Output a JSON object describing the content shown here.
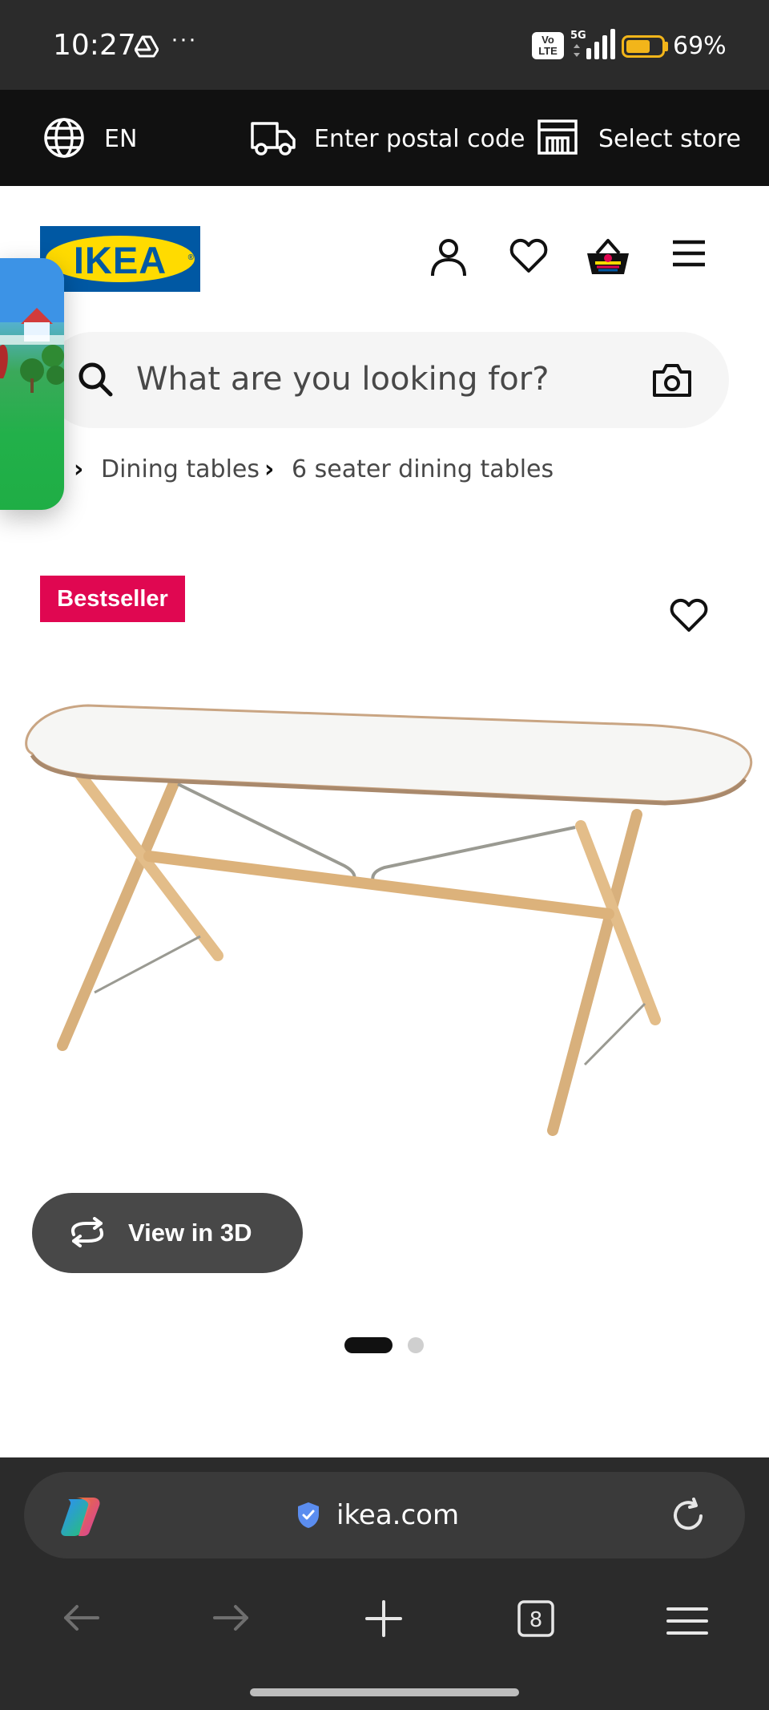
{
  "status_bar": {
    "time": "10:27",
    "more": "···",
    "volte": [
      "Vo",
      "LTE"
    ],
    "network": "5G",
    "battery_level": 0.69,
    "battery_percent": "69%"
  },
  "topbar": {
    "language": "EN",
    "postal_code_label": "Enter postal code",
    "store_label": "Select store"
  },
  "header": {
    "logo_text": "IKEA",
    "logo_mark": "®"
  },
  "search": {
    "placeholder": "What are you looking for?"
  },
  "breadcrumb": {
    "separator": "›",
    "items": [
      "Dining tables",
      "6 seater dining tables"
    ]
  },
  "product": {
    "badge": "Bestseller",
    "view_3d_label": "View in 3D",
    "image_count": 2,
    "active_image_index": 0
  },
  "browser": {
    "url": "ikea.com",
    "tab_count": "8"
  },
  "colors": {
    "ikea_blue": "#0058a3",
    "ikea_yellow": "#ffdb00",
    "badge_red": "#e00751",
    "battery": "#f2b51a"
  }
}
